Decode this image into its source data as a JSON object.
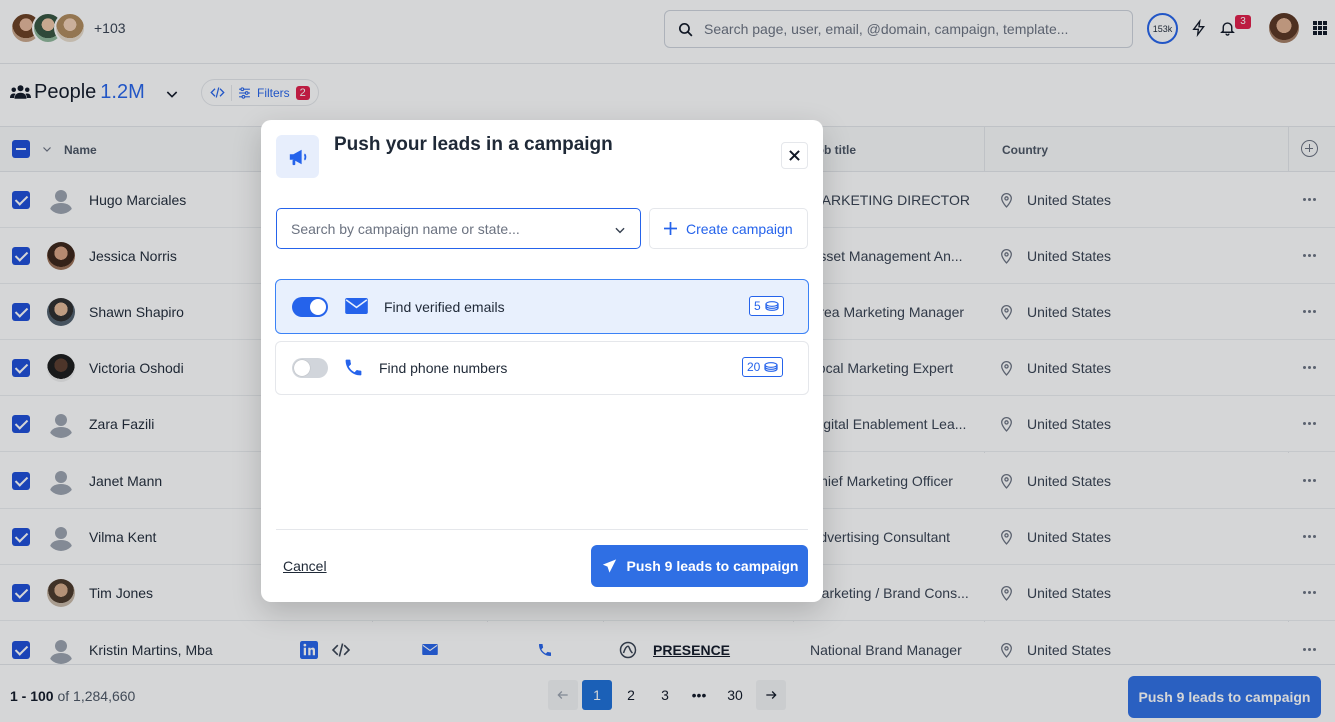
{
  "topbar": {
    "more_count": "+103",
    "search_placeholder": "Search page, user, email, @domain, campaign, template...",
    "credits": "153k",
    "notifications": "3"
  },
  "header": {
    "title": "People",
    "count": "1.2M",
    "filters_label": "Filters",
    "filters_count": "2"
  },
  "table": {
    "columns": {
      "name": "Name",
      "job_title": "Job title",
      "country": "Country"
    },
    "rows": [
      {
        "name": "Hugo Marciales",
        "job": "MARKETING DIRECTOR",
        "country": "United States"
      },
      {
        "name": "Jessica Norris",
        "job": "Asset Management An...",
        "country": "United States"
      },
      {
        "name": "Shawn Shapiro",
        "job": "Area Marketing Manager",
        "country": "United States"
      },
      {
        "name": "Victoria Oshodi",
        "job": "Local Marketing Expert",
        "country": "United States"
      },
      {
        "name": "Zara Fazili",
        "job": "Digital Enablement Lea...",
        "country": "United States"
      },
      {
        "name": "Janet Mann",
        "job": "Chief Marketing Officer",
        "country": "United States"
      },
      {
        "name": "Vilma Kent",
        "job": "Advertising Consultant",
        "country": "United States"
      },
      {
        "name": "Tim Jones",
        "job": "Marketing / Brand Cons...",
        "country": "United States"
      },
      {
        "name": "Kristin Martins, Mba",
        "job": "National Brand Manager",
        "country": "United States",
        "company": "PRESENCE"
      }
    ]
  },
  "footer": {
    "range": "1 - 100",
    "of_total": "of 1,284,660",
    "pages": [
      "1",
      "2",
      "3",
      "•••",
      "30"
    ],
    "push_label": "Push 9 leads to campaign"
  },
  "modal": {
    "title": "Push your leads in a campaign",
    "search_placeholder": "Search by campaign name or state...",
    "create_label": "Create campaign",
    "options": [
      {
        "label": "Find verified emails",
        "cost": "5",
        "enabled": true
      },
      {
        "label": "Find phone numbers",
        "cost": "20",
        "enabled": false
      }
    ],
    "cancel_label": "Cancel",
    "push_label": "Push 9 leads to campaign"
  }
}
